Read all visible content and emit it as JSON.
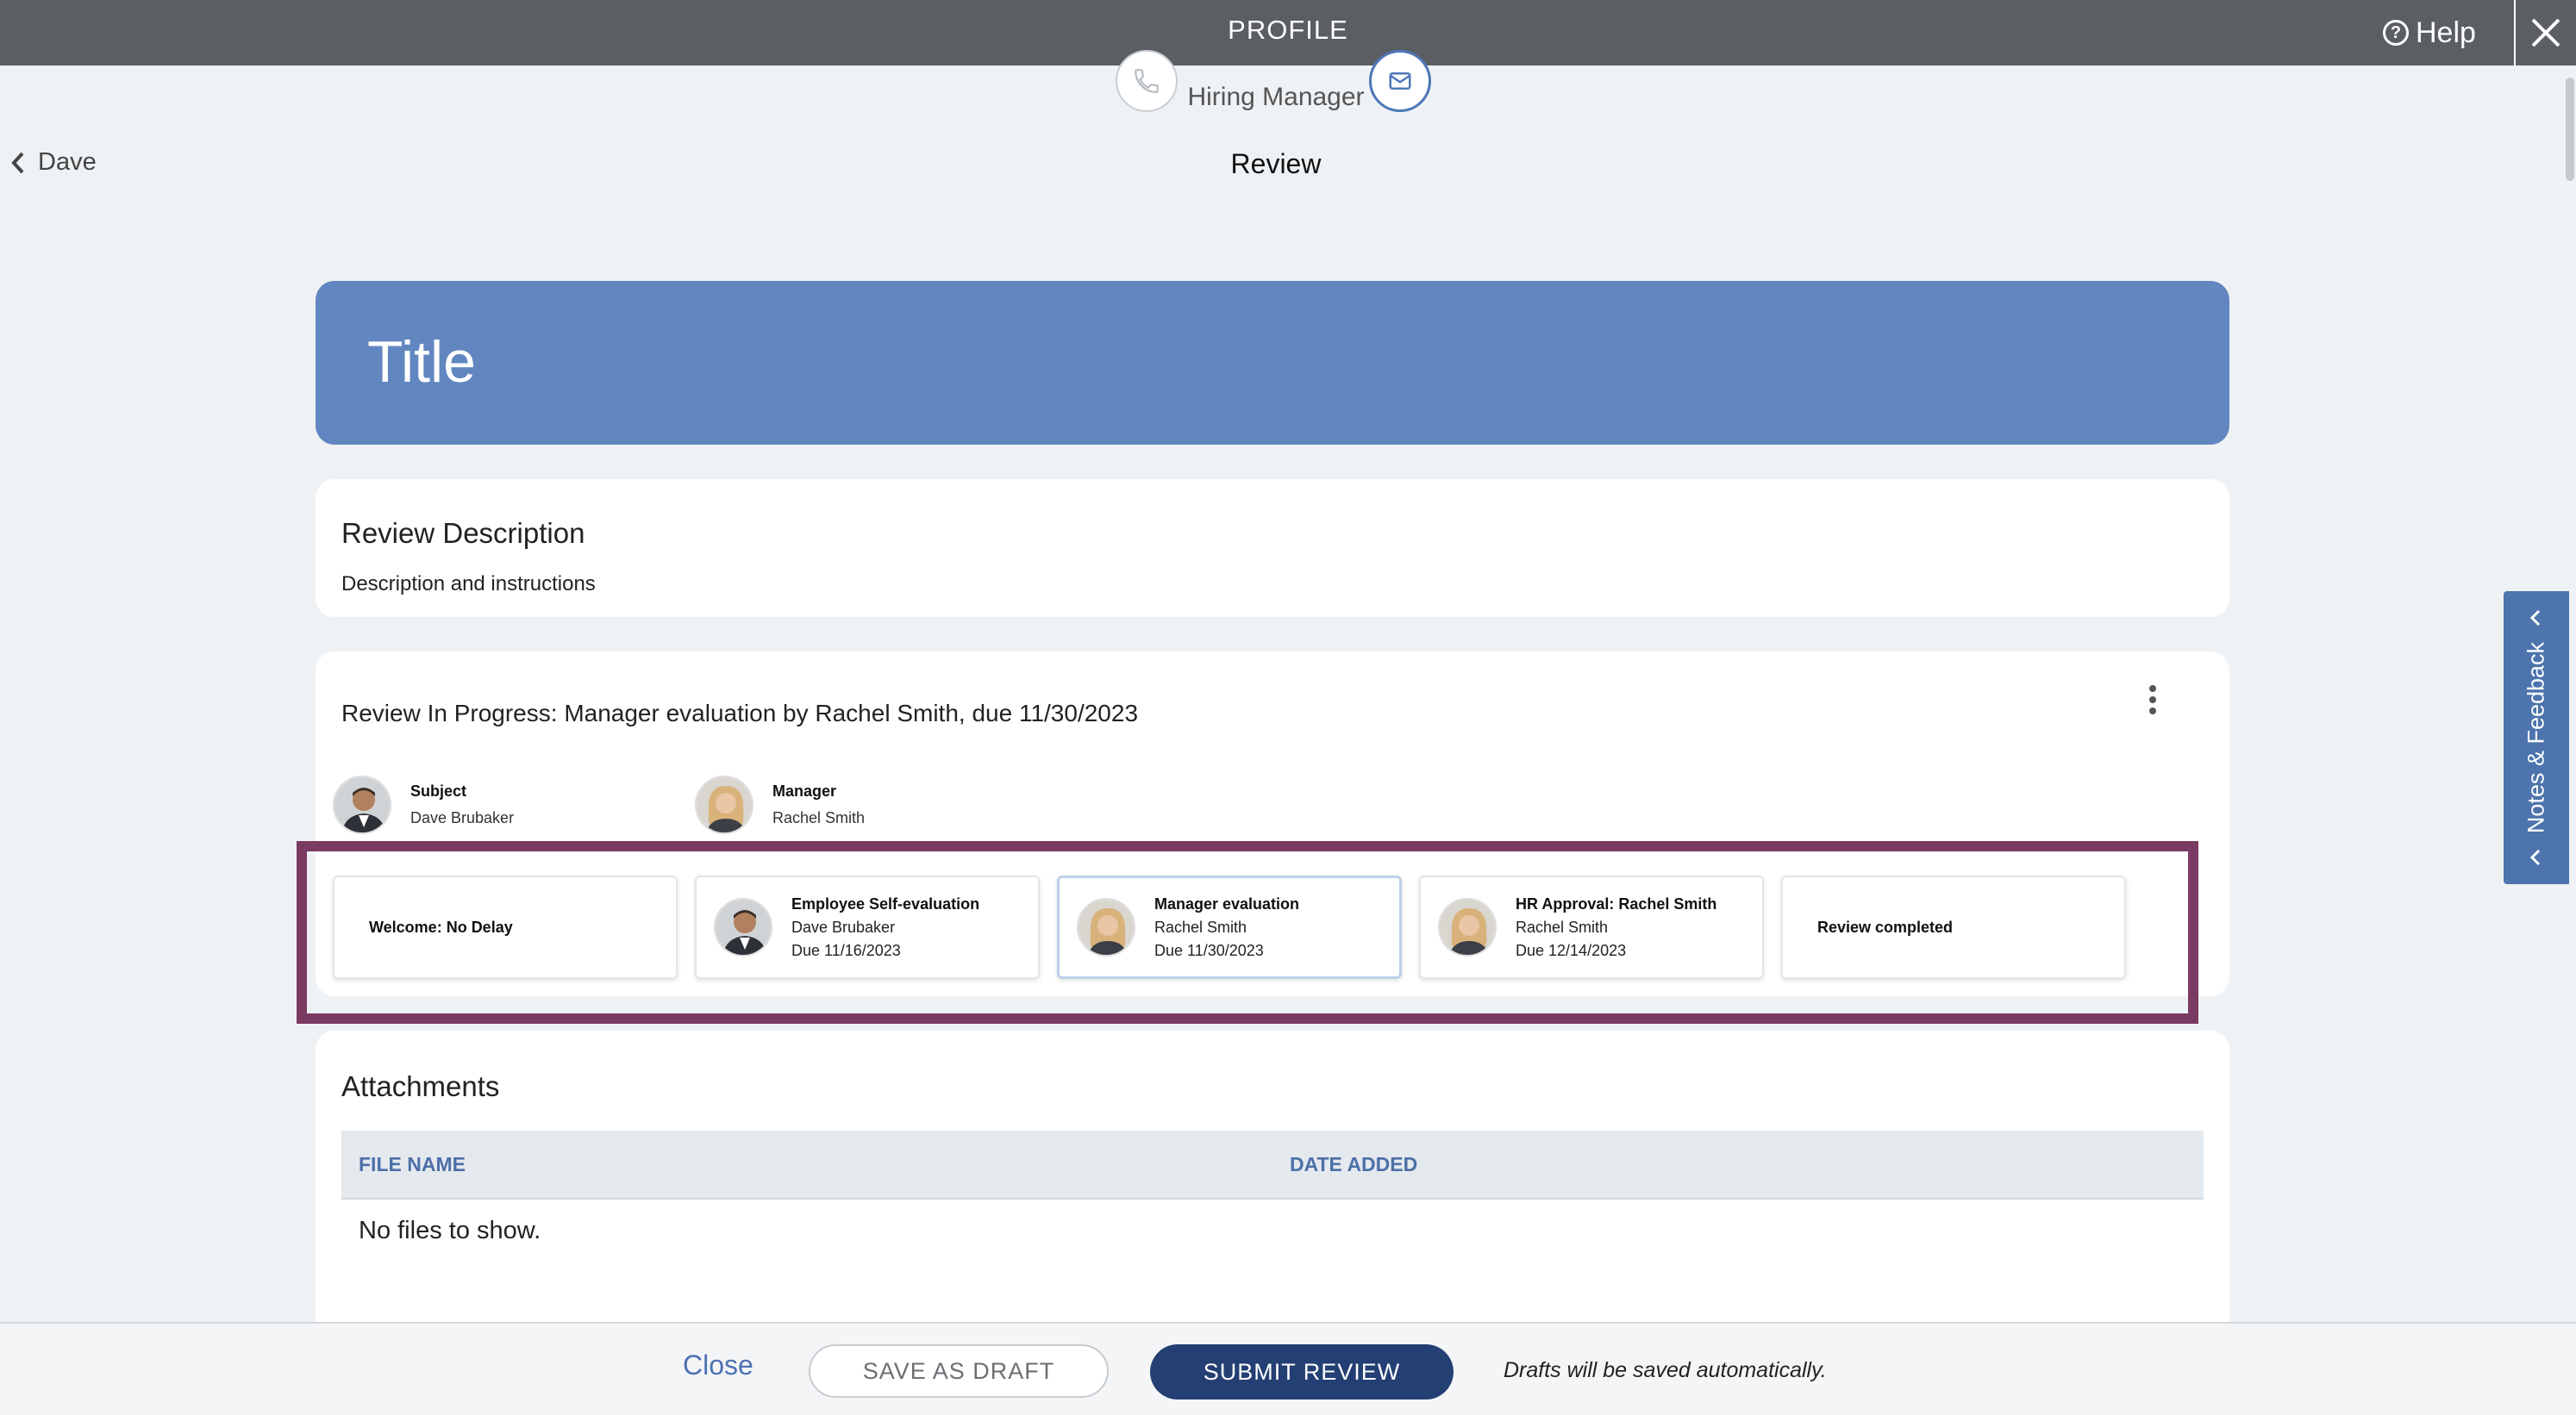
{
  "topbar": {
    "title": "PROFILE",
    "help_label": "Help"
  },
  "contact": {
    "name": "Dave Brubaker",
    "role": "Hiring Manager"
  },
  "nav": {
    "back_label": "Dave",
    "page_title": "Review"
  },
  "banner": {
    "title": "Title"
  },
  "description": {
    "heading": "Review Description",
    "text": "Description and instructions"
  },
  "review": {
    "status": "Review In Progress: Manager evaluation by Rachel Smith, due 11/30/2023",
    "subject": {
      "role": "Subject",
      "name": "Dave Brubaker"
    },
    "manager": {
      "role": "Manager",
      "name": "Rachel Smith"
    },
    "steps": [
      {
        "title": "Welcome: No Delay"
      },
      {
        "title": "Employee Self-evaluation",
        "person": "Dave Brubaker",
        "due": "Due 11/16/2023"
      },
      {
        "title": "Manager evaluation",
        "person": "Rachel Smith",
        "due": "Due 11/30/2023"
      },
      {
        "title": "HR Approval: Rachel Smith",
        "person": "Rachel Smith",
        "due": "Due 12/14/2023"
      },
      {
        "title": "Review completed"
      }
    ]
  },
  "attachments": {
    "heading": "Attachments",
    "columns": [
      "FILE NAME",
      "DATE ADDED"
    ],
    "empty_text": "No files to show."
  },
  "footer": {
    "close_label": "Close",
    "draft_label": "SAVE AS DRAFT",
    "submit_label": "SUBMIT REVIEW",
    "note": "Drafts will be saved automatically."
  },
  "side_tab": {
    "label": "Notes & Feedback"
  },
  "colors": {
    "topbar": "#5b5e62",
    "banner": "#6287c0",
    "submit": "#233f73",
    "highlight": "#7b3a61",
    "side_tab": "#4d74ad",
    "link": "#4d72b3"
  },
  "icons": [
    "help-icon",
    "close-icon",
    "phone-icon",
    "mail-icon",
    "chevron-left-icon",
    "kebab-menu-icon"
  ]
}
